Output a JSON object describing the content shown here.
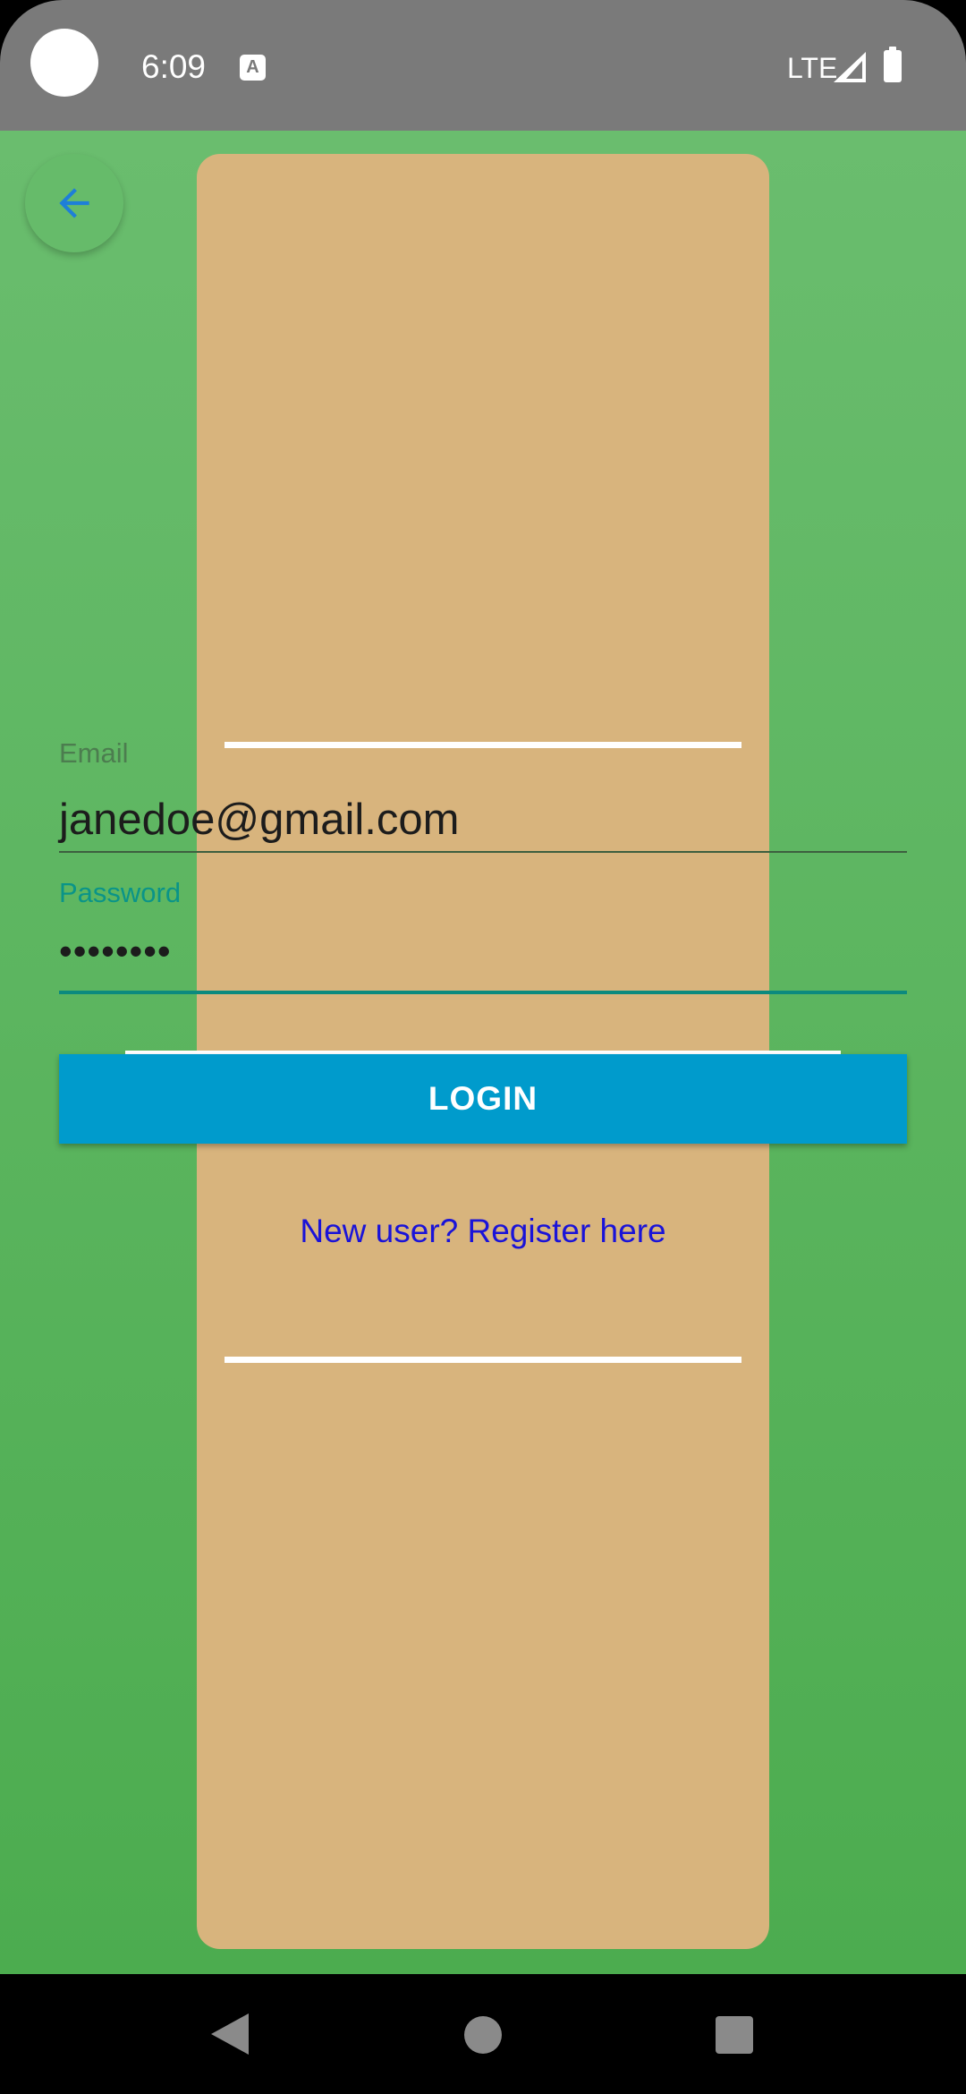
{
  "status_bar": {
    "time": "6:09",
    "notification_icon": "A",
    "network": "LTE",
    "icons": [
      "signal-icon",
      "battery-icon"
    ]
  },
  "header": {
    "back_icon": "arrow-left-icon"
  },
  "form": {
    "email": {
      "label": "Email",
      "value": "janedoe@gmail.com"
    },
    "password": {
      "label": "Password",
      "value": "••••••••"
    },
    "login_label": "LOGIN",
    "register_link": "New user? Register here"
  },
  "colors": {
    "background": "#5cb660",
    "panel": "#d8b47d",
    "login_button": "#009bcc",
    "link": "#1a13d8",
    "accent_teal": "#0a9488"
  },
  "nav_bar": {
    "icons": [
      "nav-back-icon",
      "nav-home-icon",
      "nav-recents-icon"
    ]
  }
}
